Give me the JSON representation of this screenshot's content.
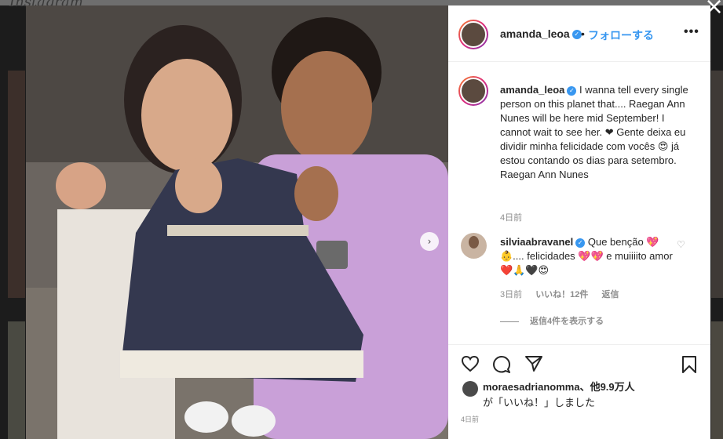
{
  "post": {
    "author": "amanda_leoa",
    "follow_label": "フォローする",
    "separator": "•",
    "more_label": "•••",
    "caption_text": "I wanna tell every single person on this planet that.... Raegan Ann Nunes will be here mid September! I cannot wait to see her. ❤ Gente deixa eu dividir minha felicidade com vocês 😍 já estou contando os dias para setembro. Raegan Ann Nunes",
    "caption_time": "4日前",
    "verified_icon": "✓",
    "accent_color": "#3897f0"
  },
  "comment": {
    "user": "silviaabravanel",
    "text": "Que benção 💖 👶.... felicidades 💖💖 e muiiiito amor ❤️🙏🖤😍",
    "time": "3日前",
    "likes": "いいね！12件",
    "reply_label": "返信",
    "view_replies": "返信4件を表示する"
  },
  "actions": {
    "like_icon": "heart-icon",
    "comment_icon": "comment-icon",
    "share_icon": "share-icon",
    "save_icon": "bookmark-icon"
  },
  "likes_summary": {
    "user": "moraesadrianomma",
    "others": "、他9.9万人",
    "suffix": "が「いいね！」しました"
  },
  "post_time": "4日前",
  "background": {
    "logo": "Instagram"
  },
  "close_label": "×",
  "next_label": "›"
}
